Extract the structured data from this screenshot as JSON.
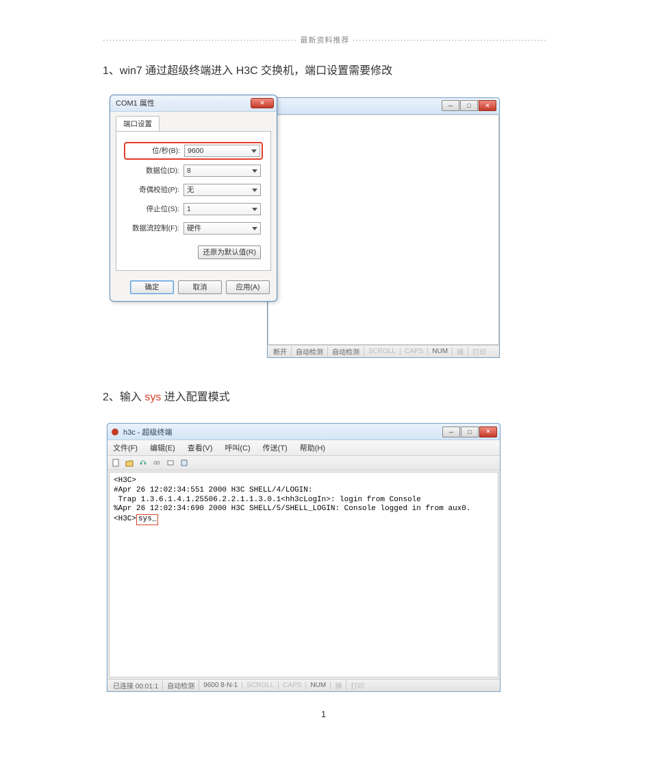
{
  "header": {
    "text": "最新资料推荐"
  },
  "step1": {
    "heading_prefix": "1、",
    "heading_text": "win7 通过超级终端进入 H3C 交换机，端口设置需要修改"
  },
  "dialog": {
    "title": "COM1 属性",
    "tab": "端口设置",
    "fields": {
      "bps": {
        "label": "位/秒(B):",
        "value": "9600"
      },
      "databits": {
        "label": "数据位(D):",
        "value": "8"
      },
      "parity": {
        "label": "奇偶校验(P):",
        "value": "无"
      },
      "stopbits": {
        "label": "停止位(S):",
        "value": "1"
      },
      "flowctrl": {
        "label": "数据流控制(F):",
        "value": "硬件"
      }
    },
    "restore_defaults": "还原为默认值(R)",
    "ok": "确定",
    "cancel": "取消",
    "apply": "应用(A)"
  },
  "host_status": {
    "cells": [
      "断开",
      "自动检测",
      "自动检测"
    ],
    "dim_cells": [
      "SCROLL",
      "CAPS",
      "NUM",
      "捕",
      "打印"
    ]
  },
  "step2": {
    "heading_prefix": "2、",
    "heading_before_red": "输入 ",
    "heading_red": "sys",
    "heading_after_red": " 进入配置模式"
  },
  "terminal": {
    "title": "h3c - 超级终端",
    "menus": [
      "文件(F)",
      "编辑(E)",
      "查看(V)",
      "呼叫(C)",
      "传送(T)",
      "帮助(H)"
    ],
    "line1": "<H3C>",
    "line2": "#Apr 26 12:02:34:551 2000 H3C SHELL/4/LOGIN:",
    "line3": " Trap 1.3.6.1.4.1.25506.2.2.1.1.3.0.1<hh3cLogIn>: login from Console",
    "line4": "%Apr 26 12:02:34:690 2000 H3C SHELL/5/SHELL_LOGIN: Console logged in from aux0.",
    "line5_pre": "<H3C>",
    "line5_cmd": "sys_",
    "status": {
      "cells": [
        "已连接 00:01:1",
        "自动检测",
        "9600 8-N-1"
      ],
      "dim_cells": [
        "SCROLL",
        "CAPS",
        "NUM",
        "捕",
        "打印"
      ]
    }
  },
  "page_number": "1"
}
